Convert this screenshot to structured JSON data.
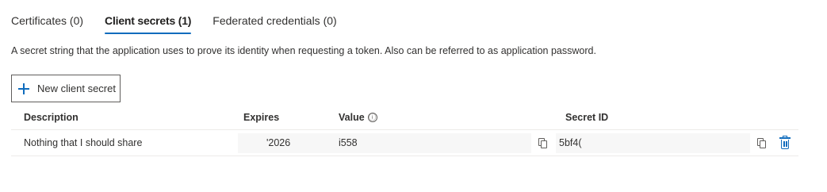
{
  "tabs": [
    {
      "label": "Certificates (0)"
    },
    {
      "label": "Client secrets (1)",
      "active": true
    },
    {
      "label": "Federated credentials (0)"
    }
  ],
  "description": "A secret string that the application uses to prove its identity when requesting a token. Also can be referred to as application password.",
  "new_button": {
    "label": "New client secret",
    "icon": "plus-icon"
  },
  "table": {
    "headers": {
      "description": "Description",
      "expires": "Expires",
      "value": "Value",
      "secret_id": "Secret ID"
    },
    "value_info_icon": "ⓘ",
    "rows": [
      {
        "description": "Nothing that I should share",
        "expires": "'2026",
        "value": "i558",
        "secret_id": "5bf4("
      }
    ]
  },
  "colors": {
    "accent": "#0f6cbd",
    "border": "#edebe9",
    "text": "#323130"
  }
}
